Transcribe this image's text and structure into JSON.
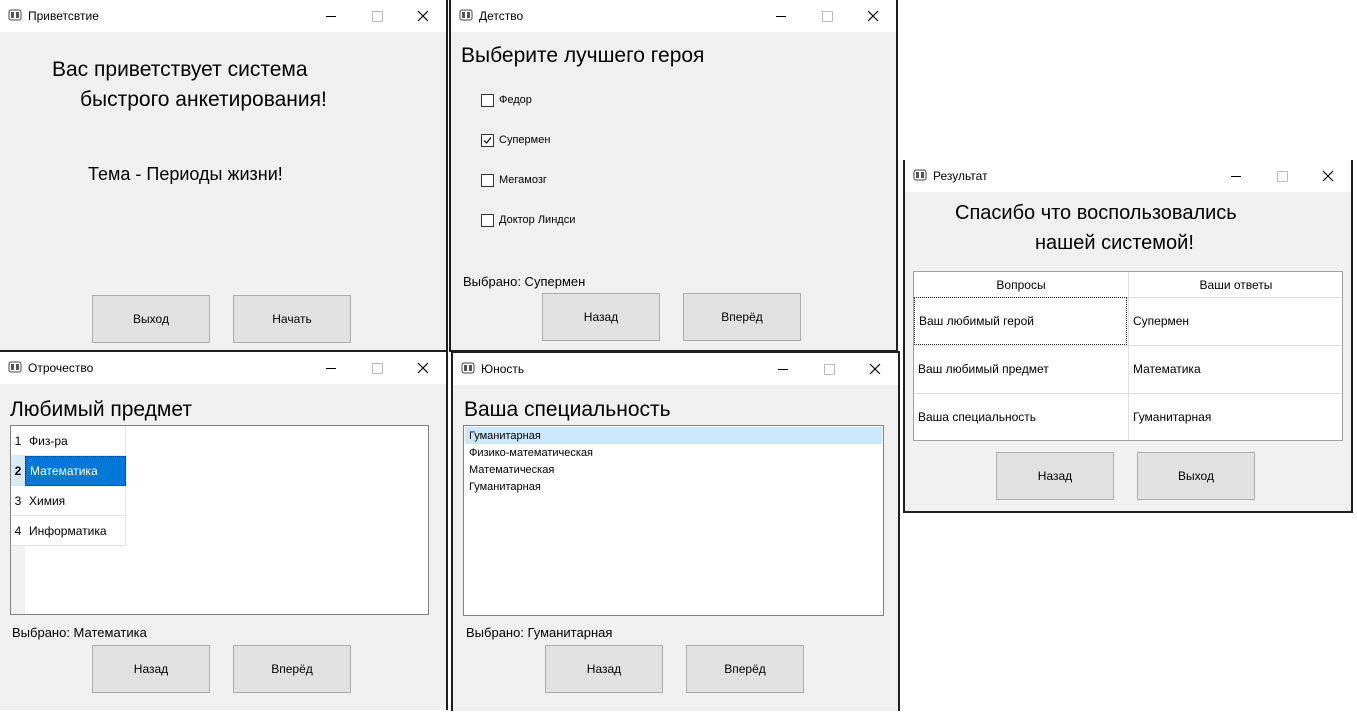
{
  "windows": {
    "welcome": {
      "title": "Приветсвтие",
      "line1": "Вас приветствует система",
      "line2": "быстрого анкетирования!",
      "topic": "Тема - Периоды жизни!",
      "exit_label": "Выход",
      "start_label": "Начать"
    },
    "childhood": {
      "title": "Детство",
      "heading": "Выберите лучшего героя",
      "options": [
        {
          "label": "Федор",
          "checked": false
        },
        {
          "label": "Супермен",
          "checked": true
        },
        {
          "label": "Мегамозг",
          "checked": false
        },
        {
          "label": "Доктор Линдси",
          "checked": false
        }
      ],
      "selected_text": "Выбрано: Супермен",
      "back_label": "Назад",
      "next_label": "Вперёд"
    },
    "adolescence": {
      "title": "Отрочество",
      "heading": "Любимый предмет",
      "rows": [
        {
          "index": "1",
          "value": "Физ-ра",
          "selected": false
        },
        {
          "index": "2",
          "value": "Математика",
          "selected": true
        },
        {
          "index": "3",
          "value": "Химия",
          "selected": false
        },
        {
          "index": "4",
          "value": "Информатика",
          "selected": false
        }
      ],
      "selected_text": "Выбрано: Математика",
      "back_label": "Назад",
      "next_label": "Вперёд"
    },
    "youth": {
      "title": "Юность",
      "heading": "Ваша специальность",
      "items": [
        {
          "label": "Гуманитарная",
          "selected": true
        },
        {
          "label": "Физико-математическая",
          "selected": false
        },
        {
          "label": "Математическая",
          "selected": false
        },
        {
          "label": "Гуманитарная",
          "selected": false
        }
      ],
      "selected_text": "Выбрано: Гуманитарная",
      "back_label": "Назад",
      "next_label": "Вперёд"
    },
    "result": {
      "title": "Результат",
      "line1": "Спасибо что воспользовались",
      "line2": "нашей системой!",
      "col_questions": "Вопросы",
      "col_answers": "Ваши ответы",
      "rows": [
        {
          "question": "Ваш любимый герой",
          "answer": "Супермен"
        },
        {
          "question": "Ваш любимый предмет",
          "answer": "Математика"
        },
        {
          "question": "Ваша специальность",
          "answer": "Гуманитарная"
        }
      ],
      "back_label": "Назад",
      "exit_label": "Выход"
    }
  }
}
